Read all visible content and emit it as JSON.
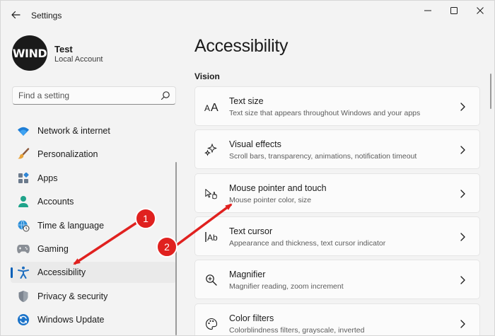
{
  "window": {
    "title": "Settings"
  },
  "profile": {
    "initials": "WIND",
    "name": "Test",
    "account_type": "Local Account"
  },
  "search": {
    "placeholder": "Find a setting"
  },
  "sidebar": {
    "items": [
      {
        "label": "Network & internet",
        "icon": "wifi-icon"
      },
      {
        "label": "Personalization",
        "icon": "brush-icon"
      },
      {
        "label": "Apps",
        "icon": "apps-icon"
      },
      {
        "label": "Accounts",
        "icon": "person-icon"
      },
      {
        "label": "Time & language",
        "icon": "globe-clock-icon"
      },
      {
        "label": "Gaming",
        "icon": "gamepad-icon"
      },
      {
        "label": "Accessibility",
        "icon": "accessibility-icon",
        "selected": true
      },
      {
        "label": "Privacy & security",
        "icon": "shield-icon"
      },
      {
        "label": "Windows Update",
        "icon": "update-icon"
      }
    ]
  },
  "main": {
    "title": "Accessibility",
    "section": "Vision",
    "cards": [
      {
        "title": "Text size",
        "desc": "Text size that appears throughout Windows and your apps",
        "icon": "text-size-icon"
      },
      {
        "title": "Visual effects",
        "desc": "Scroll bars, transparency, animations, notification timeout",
        "icon": "sparkle-icon"
      },
      {
        "title": "Mouse pointer and touch",
        "desc": "Mouse pointer color, size",
        "icon": "pointer-touch-icon"
      },
      {
        "title": "Text cursor",
        "desc": "Appearance and thickness, text cursor indicator",
        "icon": "text-cursor-icon"
      },
      {
        "title": "Magnifier",
        "desc": "Magnifier reading, zoom increment",
        "icon": "magnifier-icon"
      },
      {
        "title": "Color filters",
        "desc": "Colorblindness filters, grayscale, inverted",
        "icon": "palette-icon"
      }
    ]
  },
  "annotations": [
    {
      "label": "1"
    },
    {
      "label": "2"
    }
  ],
  "colors": {
    "accent": "#005fb8",
    "annotation": "#e0211f",
    "background": "#f3f3f3",
    "card": "#fbfbfb"
  }
}
